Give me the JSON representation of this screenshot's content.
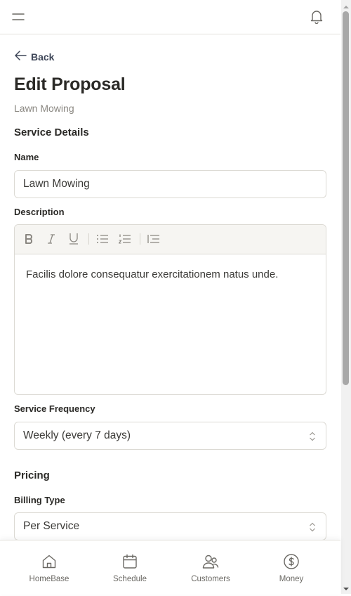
{
  "header": {
    "menu_icon": "hamburger-icon",
    "notification_icon": "bell-icon"
  },
  "page": {
    "back_label": "Back",
    "title": "Edit Proposal",
    "subtitle": "Lawn Mowing"
  },
  "service_details": {
    "section_title": "Service Details",
    "name_label": "Name",
    "name_value": "Lawn Mowing",
    "description_label": "Description",
    "description_value": "Facilis dolore consequatur exercitationem natus unde.",
    "toolbar_icons": [
      "bold-icon",
      "italic-icon",
      "underline-icon",
      "bullet-list-icon",
      "numbered-list-icon",
      "indent-icon"
    ],
    "frequency_label": "Service Frequency",
    "frequency_value": "Weekly (every 7 days)"
  },
  "pricing": {
    "section_title": "Pricing",
    "billing_type_label": "Billing Type",
    "billing_type_value": "Per Service"
  },
  "bottom_nav": {
    "items": [
      {
        "label": "HomeBase",
        "icon": "home-icon"
      },
      {
        "label": "Schedule",
        "icon": "calendar-icon"
      },
      {
        "label": "Customers",
        "icon": "users-icon"
      },
      {
        "label": "Money",
        "icon": "dollar-icon"
      }
    ]
  }
}
